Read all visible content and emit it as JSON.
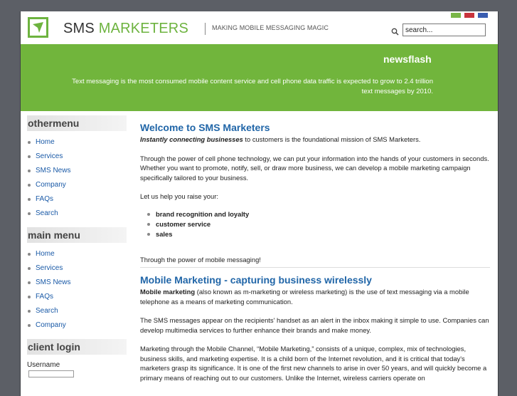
{
  "header": {
    "brand_sms": "SMS",
    "brand_marketers": "MARKETERS",
    "tagline": "MAKING MOBILE MESSAGING MAGIC",
    "search_placeholder": "search...",
    "search_value": "search...",
    "flag_colors": [
      "#7ab648",
      "#c8343c",
      "#3a5db0"
    ]
  },
  "newsflash": {
    "title": "newsflash",
    "text": "Text messaging is the most consumed mobile content service and cell phone data traffic is expected to grow to 2.4 trillion text messages by 2010."
  },
  "sidebar": {
    "othermenu_title": "othermenu",
    "othermenu_items": [
      "Home",
      "Services",
      "SMS News",
      "Company",
      "FAQs",
      "Search"
    ],
    "mainmenu_title": "main menu",
    "mainmenu_items": [
      "Home",
      "Services",
      "SMS News",
      "FAQs",
      "Search",
      "Company"
    ],
    "login_title": "client login",
    "username_label": "Username"
  },
  "article1": {
    "title": "Welcome to SMS Marketers",
    "lead_bold": "Instantly connecting businesses",
    "lead_rest": " to customers is the foundational mission of SMS Marketers.",
    "p2": "Through the power of cell phone technology, we can put your information into the hands of your customers in seconds.  Whether you want to promote, notify, sell, or draw more business, we can develop a mobile marketing campaign specifically tailored to your business.",
    "p3": "Let us help you raise your:",
    "bullets": [
      "brand recognition and loyalty",
      "customer service",
      "sales"
    ],
    "p4": "Through the power of mobile messaging!"
  },
  "article2": {
    "title": "Mobile Marketing - capturing business wirelessly",
    "p1_bold": "Mobile marketing",
    "p1_rest": " (also known as m-marketing or wireless marketing) is the use of text messaging via a mobile telephone as a means of marketing communication.",
    "p2": "The SMS messages appear on the recipients' handset as an alert in the inbox making it simple to use. Companies can develop multimedia services to further enhance their brands and make money.",
    "p3": "Marketing through the Mobile Channel, “Mobile Marketing,” consists of a unique, complex, mix of technologies, business skills, and marketing expertise. It is a child born of the Internet revolution, and it is critical that today's marketers grasp its significance. It is one of the first new channels to arise in over 50 years, and will quickly become a primary means of reaching out to our customers. Unlike the Internet, wireless carriers operate on"
  },
  "colors": {
    "accent_green": "#71b53c",
    "link_blue": "#1a5aa7",
    "heading_blue": "#2166a8"
  }
}
